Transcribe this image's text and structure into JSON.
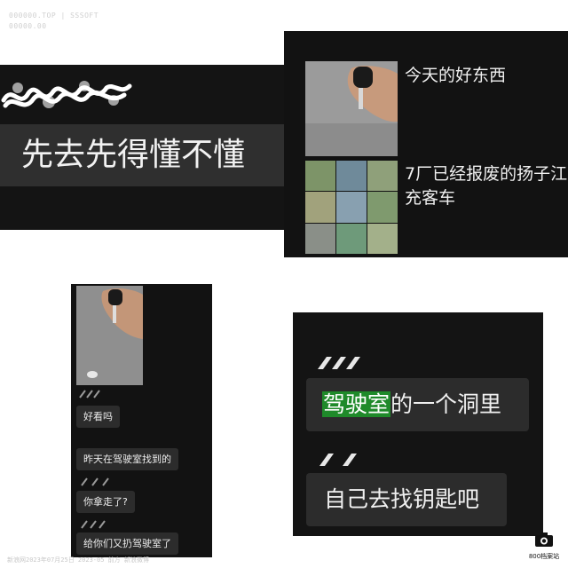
{
  "watermark_top_left": "000000.TOP | SSSOFT",
  "watermark_top_left_sub": "00000.00",
  "watermark_bottom_left": "新浪网2023年07月25日 2023-05 前方 新浪微博",
  "panel1": {
    "message": "先去先得懂不懂"
  },
  "panel2": {
    "message1": "今天的好东西",
    "message2_line1": "7厂已经报废的扬子江",
    "message2_line2": "充客车"
  },
  "panel3": {
    "messages": [
      "好看吗",
      "昨天在驾驶室找到的",
      "你拿走了?",
      "给你们又扔驾驶室了"
    ]
  },
  "panel4": {
    "highlight": "驾驶室",
    "message1_rest": "的一个洞里",
    "message2": "自己去找钥匙吧"
  },
  "logo": {
    "text": "800档案站",
    "icon": "camera-icon"
  },
  "colors": {
    "dark_bg": "#121212",
    "bubble": "#2c2c2c",
    "highlight": "#1f8a2a"
  }
}
